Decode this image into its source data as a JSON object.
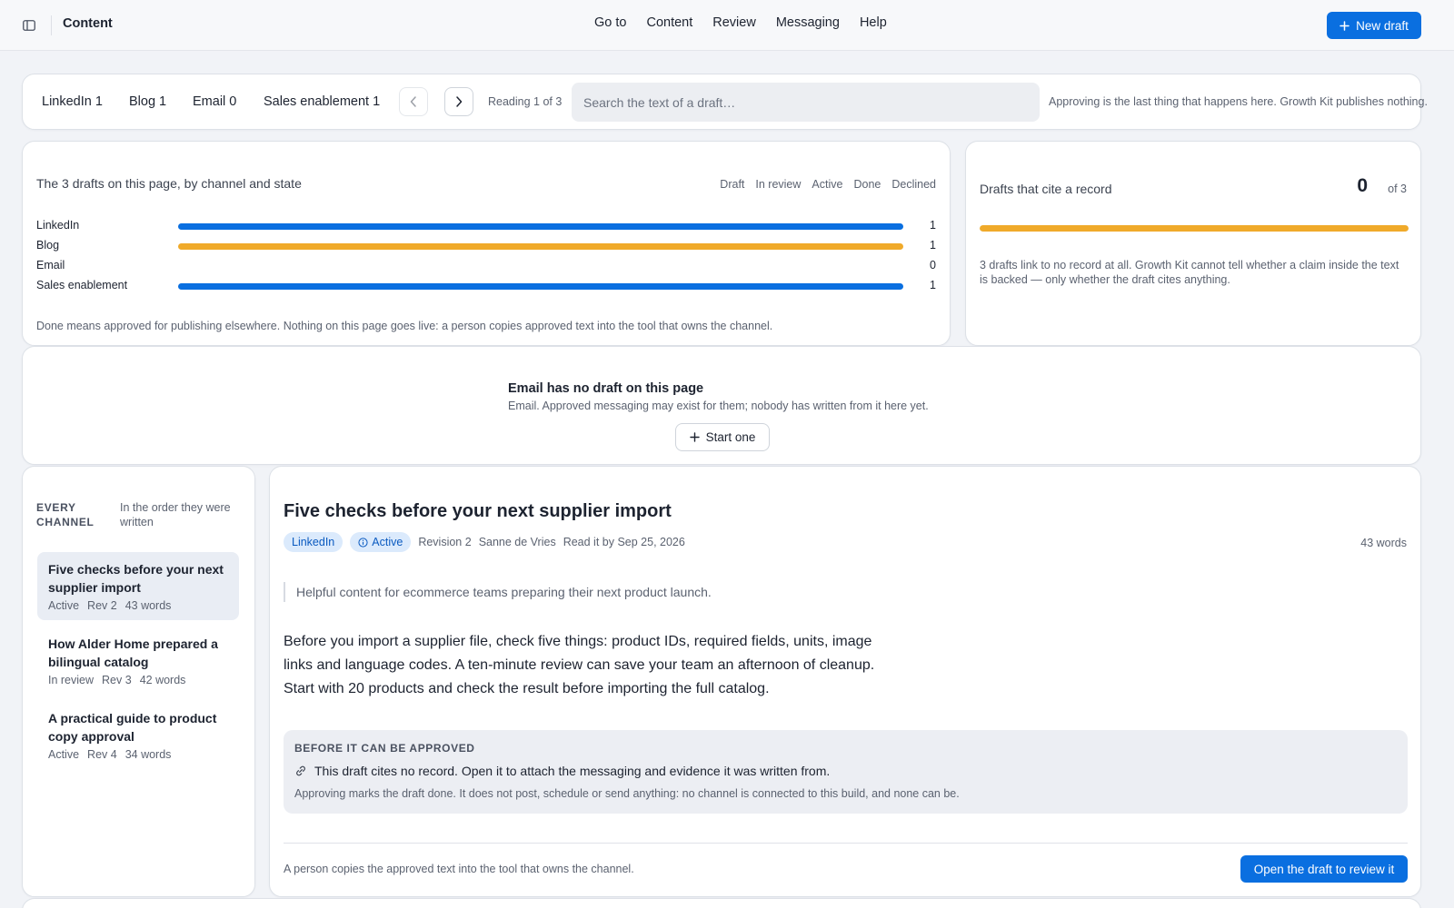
{
  "topbar": {
    "title": "Content",
    "nav": [
      "Go to",
      "Content",
      "Review",
      "Messaging",
      "Help"
    ],
    "new_draft_label": "New draft"
  },
  "filter": {
    "tabs": [
      "LinkedIn 1",
      "Blog 1",
      "Email 0",
      "Sales enablement 1"
    ],
    "reading": "Reading 1 of 3",
    "search_placeholder": "Search the text of a draft…",
    "note": "Approving is the last thing that happens here. Growth Kit publishes nothing."
  },
  "channel_chart": {
    "title": "The 3 drafts on this page, by channel and state",
    "legend": [
      "Draft",
      "In review",
      "Active",
      "Done",
      "Declined"
    ],
    "colors": {
      "active": "#0a6fe0",
      "in_review": "#f0aa2a"
    },
    "rows": [
      {
        "label": "LinkedIn",
        "count": "1",
        "state": "active"
      },
      {
        "label": "Blog",
        "count": "1",
        "state": "in_review"
      },
      {
        "label": "Email",
        "count": "0",
        "state": "none"
      },
      {
        "label": "Sales enablement",
        "count": "1",
        "state": "active"
      }
    ],
    "footnote": "Done means approved for publishing elsewhere. Nothing on this page goes live: a person copies approved text into the tool that owns the channel."
  },
  "cite": {
    "title": "Drafts that cite a record",
    "count": "0",
    "of": "of 3",
    "uncited_fraction": 1.0,
    "bar_color": "#f0aa2a",
    "note": "3 drafts link to no record at all. Growth Kit cannot tell whether a claim inside the text is backed — only whether the draft cites anything."
  },
  "empty_channel": {
    "title": "Email has no draft on this page",
    "subtitle": "Email. Approved messaging may exist for them; nobody has written from it here yet.",
    "button": "Start one"
  },
  "list": {
    "heading": "EVERY CHANNEL",
    "subheading": "In the order they were written",
    "items": [
      {
        "title": "Five checks before your next supplier import",
        "state": "Active",
        "rev": "Rev 2",
        "words": "43 words",
        "selected": true
      },
      {
        "title": "How Alder Home prepared a bilingual catalog",
        "state": "In review",
        "rev": "Rev 3",
        "words": "42 words",
        "selected": false
      },
      {
        "title": "A practical guide to product copy approval",
        "state": "Active",
        "rev": "Rev 4",
        "words": "34 words",
        "selected": false
      }
    ]
  },
  "detail": {
    "title": "Five checks before your next supplier import",
    "channel": "LinkedIn",
    "state": "Active",
    "revision": "Revision 2",
    "author": "Sanne de Vries",
    "read_by": "Read it by Sep 25, 2026",
    "words": "43 words",
    "brief": "Helpful content for ecommerce teams preparing their next product launch.",
    "body": "Before you import a supplier file, check five things: product IDs, required fields, units, image links and language codes. A ten-minute review can save your team an afternoon of cleanup. Start with 20 products and check the result before importing the full catalog.",
    "approval": {
      "heading": "BEFORE IT CAN BE APPROVED",
      "issue": "This draft cites no record. Open it to attach the messaging and evidence it was written from.",
      "note": "Approving marks the draft done. It does not post, schedule or send anything: no channel is connected to this build, and none can be."
    },
    "footer_note": "A person copies the approved text into the tool that owns the channel.",
    "open_button": "Open the draft to review it"
  }
}
